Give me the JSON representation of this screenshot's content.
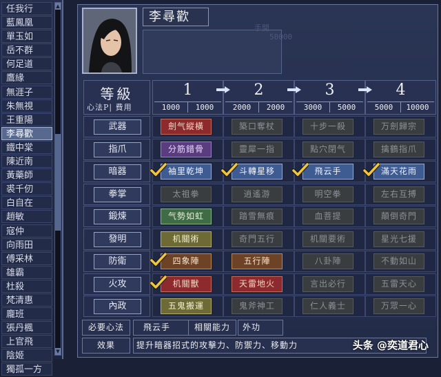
{
  "sidebar": {
    "characters": [
      "任我行",
      "藍鳳凰",
      "單玉如",
      "岳不群",
      "何足道",
      "鷹緣",
      "無涯子",
      "朱無視",
      "王重陽",
      "李尋歡",
      "鐵中棠",
      "陳近南",
      "黃藥師",
      "裘千仞",
      "白自在",
      "趙敏",
      "寇仲",
      "向雨田",
      "傅采林",
      "雄霸",
      "杜殺",
      "梵清惠",
      "龐班",
      "張丹楓",
      "上官飛",
      "陰姬",
      "獨孤一方"
    ],
    "selected": "李尋歡"
  },
  "hero": {
    "name": "李尋歡"
  },
  "ghost": {
    "label": "手開",
    "value": "50000"
  },
  "header": {
    "level_label": "等級",
    "sub_label": "心法P| 費用",
    "levels": [
      {
        "num": "1",
        "cost_a": "1000",
        "cost_b": "1000"
      },
      {
        "num": "2",
        "cost_a": "2000",
        "cost_b": "2000"
      },
      {
        "num": "3",
        "cost_a": "3000",
        "cost_b": "5000"
      },
      {
        "num": "4",
        "cost_a": "5000",
        "cost_b": "10000"
      }
    ]
  },
  "rows": [
    {
      "category": "武器",
      "skills": [
        {
          "name": "劍气縱橫",
          "style": "red",
          "checked": false
        },
        {
          "name": "築口奪杖",
          "style": "dim",
          "checked": false
        },
        {
          "name": "十步一殺",
          "style": "dim",
          "checked": false
        },
        {
          "name": "万劍歸宗",
          "style": "dim",
          "checked": false
        }
      ]
    },
    {
      "category": "指爪",
      "skills": [
        {
          "name": "分筋錯骨",
          "style": "purple",
          "checked": false
        },
        {
          "name": "靈犀一指",
          "style": "dim",
          "checked": false
        },
        {
          "name": "點穴閉气",
          "style": "dim",
          "checked": false
        },
        {
          "name": "擒鶴指爪",
          "style": "dim",
          "checked": false
        }
      ]
    },
    {
      "category": "暗器",
      "skills": [
        {
          "name": "袖里乾坤",
          "style": "blue",
          "checked": true
        },
        {
          "name": "斗轉星移",
          "style": "blue",
          "checked": true
        },
        {
          "name": "飛云手",
          "style": "blue",
          "checked": true
        },
        {
          "name": "滿天花雨",
          "style": "blue",
          "checked": true
        }
      ]
    },
    {
      "category": "拳掌",
      "skills": [
        {
          "name": "太祖拳",
          "style": "dim",
          "checked": false
        },
        {
          "name": "逍遙游",
          "style": "dim",
          "checked": false
        },
        {
          "name": "明空拳",
          "style": "dim",
          "checked": false
        },
        {
          "name": "左右互搏",
          "style": "dim",
          "checked": false
        }
      ]
    },
    {
      "category": "鍛煉",
      "skills": [
        {
          "name": "气勢如虹",
          "style": "green",
          "checked": false
        },
        {
          "name": "踏雪無痕",
          "style": "dim",
          "checked": false
        },
        {
          "name": "血菩提",
          "style": "dim",
          "checked": false
        },
        {
          "name": "顛倒奇門",
          "style": "dim",
          "checked": false
        }
      ]
    },
    {
      "category": "發明",
      "skills": [
        {
          "name": "机關術",
          "style": "olive",
          "checked": false
        },
        {
          "name": "奇門五行",
          "style": "dim",
          "checked": false
        },
        {
          "name": "机關要術",
          "style": "dim",
          "checked": false
        },
        {
          "name": "星光七援",
          "style": "dim",
          "checked": false
        }
      ]
    },
    {
      "category": "防衛",
      "skills": [
        {
          "name": "四象陣",
          "style": "brown",
          "checked": true
        },
        {
          "name": "五行陣",
          "style": "brown",
          "checked": false
        },
        {
          "name": "八卦陣",
          "style": "dim",
          "checked": false
        },
        {
          "name": "不動如山",
          "style": "dim",
          "checked": false
        }
      ]
    },
    {
      "category": "火攻",
      "skills": [
        {
          "name": "机關獸",
          "style": "red",
          "checked": true
        },
        {
          "name": "天雷地火",
          "style": "red",
          "checked": false
        },
        {
          "name": "言出必行",
          "style": "dim",
          "checked": false
        },
        {
          "name": "五雷天心",
          "style": "dim",
          "checked": false
        }
      ]
    },
    {
      "category": "內政",
      "skills": [
        {
          "name": "五鬼搬運",
          "style": "olive",
          "checked": false
        },
        {
          "name": "鬼斧神工",
          "style": "dim",
          "checked": false
        },
        {
          "name": "仁人義士",
          "style": "dim",
          "checked": false
        },
        {
          "name": "万眾一心",
          "style": "dim",
          "checked": false
        }
      ]
    }
  ],
  "footer": {
    "req_label": "必要心法",
    "req_value": "飛云手",
    "rel_label": "相關能力",
    "rel_value": "外功",
    "effect_label": "效果",
    "effect_value": "提升暗器招式的攻擊力、防禦力、移動力"
  },
  "watermark": "头条 @奕道君心",
  "colors": {
    "check": "#f2c63a",
    "arrow": "#d8e2f8"
  }
}
